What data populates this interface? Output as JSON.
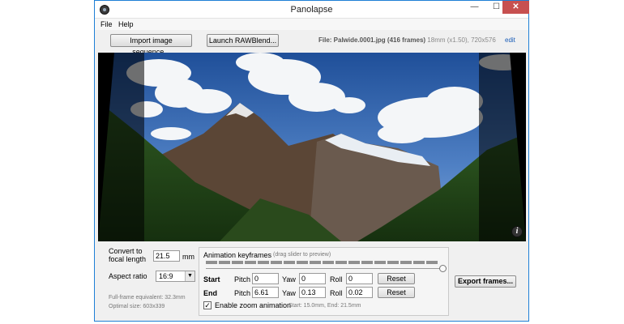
{
  "window": {
    "title": "Panolapse",
    "min_glyph": "—",
    "max_glyph": "☐",
    "close_glyph": "✕"
  },
  "menu": {
    "file": "File",
    "help": "Help"
  },
  "toolbar": {
    "import_label": "Import image sequence...",
    "rawblend_label": "Launch RAWBlend...",
    "file_name": "File: Palwide.0001.jpg (416 frames)",
    "file_meta": "18mm (x1.50), 720x576",
    "edit_label": "edit"
  },
  "viewer": {
    "info_glyph": "i"
  },
  "settings": {
    "convert_label_1": "Convert to",
    "convert_label_2": "focal length",
    "focal_value": "21.5",
    "focal_unit": "mm",
    "aspect_label": "Aspect ratio",
    "aspect_value": "16:9",
    "fullframe_note": "Full-frame equivalent: 32.3mm",
    "optimal_note": "Optimal size: 603x339"
  },
  "keyframes": {
    "title": "Animation keyframes",
    "hint": "(drag slider to preview)",
    "slider_position": 1.0,
    "start_label": "Start",
    "end_label": "End",
    "pitch_label": "Pitch",
    "yaw_label": "Yaw",
    "roll_label": "Roll",
    "reset_label": "Reset",
    "start": {
      "pitch": "0",
      "yaw": "0",
      "roll": "0"
    },
    "end": {
      "pitch": "6.61",
      "yaw": "0.13",
      "roll": "0.02"
    },
    "zoom_checked": "✓",
    "zoom_label": "Enable zoom animation",
    "zoom_note": "Start: 15.0mm, End: 21.5mm"
  },
  "export_label": "Export frames..."
}
